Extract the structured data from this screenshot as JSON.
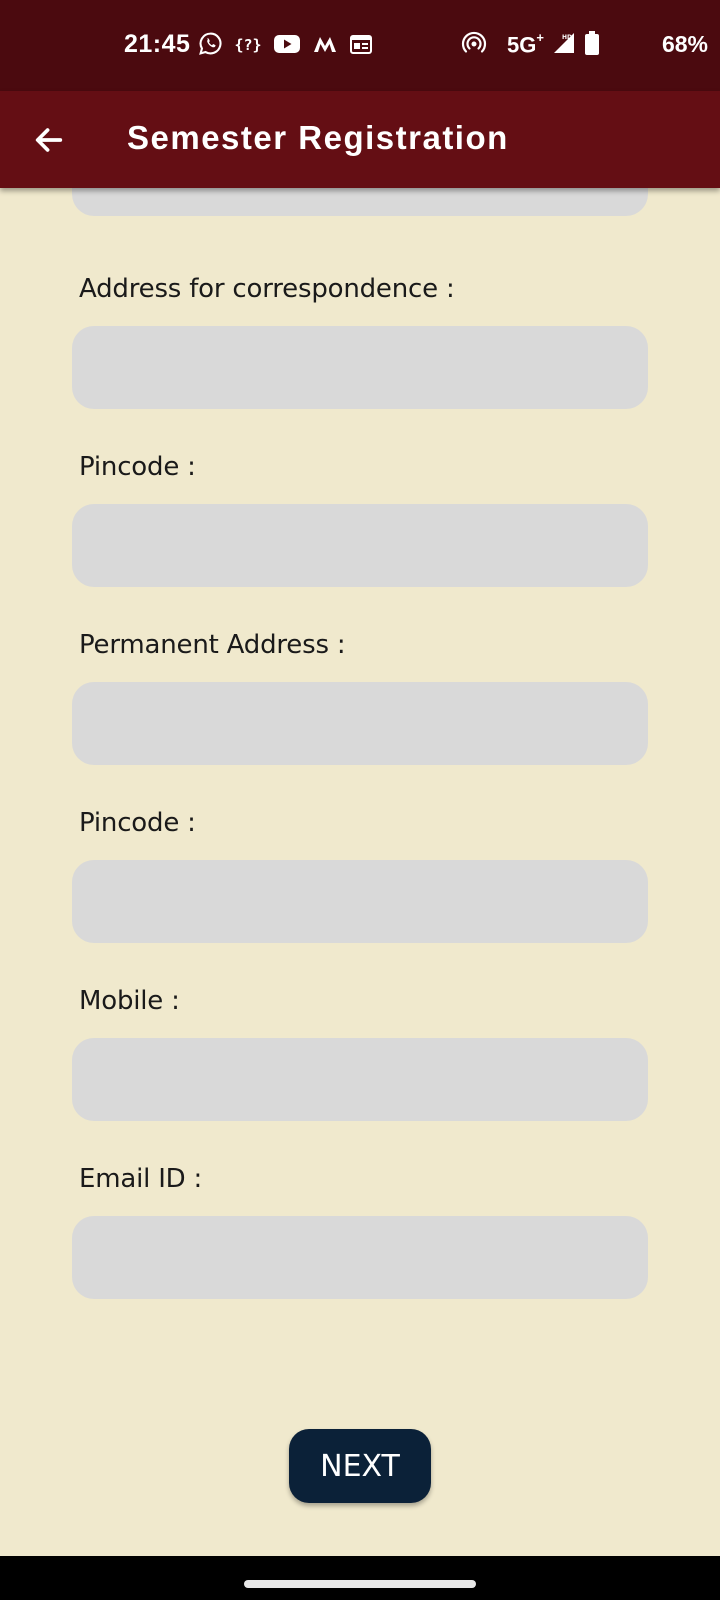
{
  "status_bar": {
    "time": "21:45",
    "network": "5G",
    "network_sup": "+",
    "battery": "68%",
    "bg_color": "#4b0a0f"
  },
  "app_bar": {
    "title": "Semester Registration",
    "bg_color": "#640e14",
    "back_icon": "arrow-left-icon"
  },
  "form": {
    "background": "#f0e9cd",
    "input_color": "#d9d9d9",
    "fields": [
      {
        "label": "Address for correspondence :",
        "value": "",
        "placeholder": ""
      },
      {
        "label": "Pincode :",
        "value": "",
        "placeholder": ""
      },
      {
        "label": "Permanent Address :",
        "value": "",
        "placeholder": ""
      },
      {
        "label": "Pincode :",
        "value": "",
        "placeholder": ""
      },
      {
        "label": "Mobile :",
        "value": "",
        "placeholder": ""
      },
      {
        "label": "Email ID :",
        "value": "",
        "placeholder": ""
      }
    ],
    "next_label": "NEXT",
    "next_color": "#0b2138"
  }
}
